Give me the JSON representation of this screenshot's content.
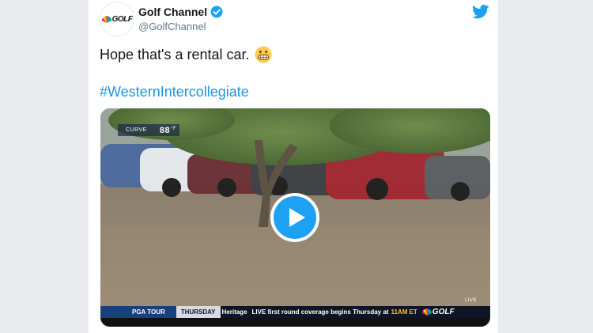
{
  "tweet": {
    "author_name": "Golf Channel",
    "handle": "@GolfChannel",
    "avatar_logo_text": "GOLF",
    "text": "Hope that's a rental car.",
    "emoji": "grimacing-face",
    "hashtag": "#WesternIntercollegiate",
    "icons": [
      "verified-badge-icon",
      "twitter-bird-icon",
      "play-icon",
      "peacock-icon"
    ]
  },
  "video": {
    "curve_label": "CURVE",
    "curve_value": "88",
    "curve_unit": "°F",
    "ticker": {
      "tour": "PGA TOUR",
      "day": "THURSDAY",
      "event": "Heritage",
      "live_text": "LIVE first round coverage begins Thursday at",
      "live_time": "11AM ET",
      "brand": "GOLF"
    },
    "live_bug": "LIVE"
  },
  "colors": {
    "link": "#1b95e0",
    "twitter_blue": "#1da1f2",
    "ticker_bg": "#0d1526",
    "ticker_tour_bg": "#1a3f7a",
    "ticker_time": "#f5c518"
  }
}
